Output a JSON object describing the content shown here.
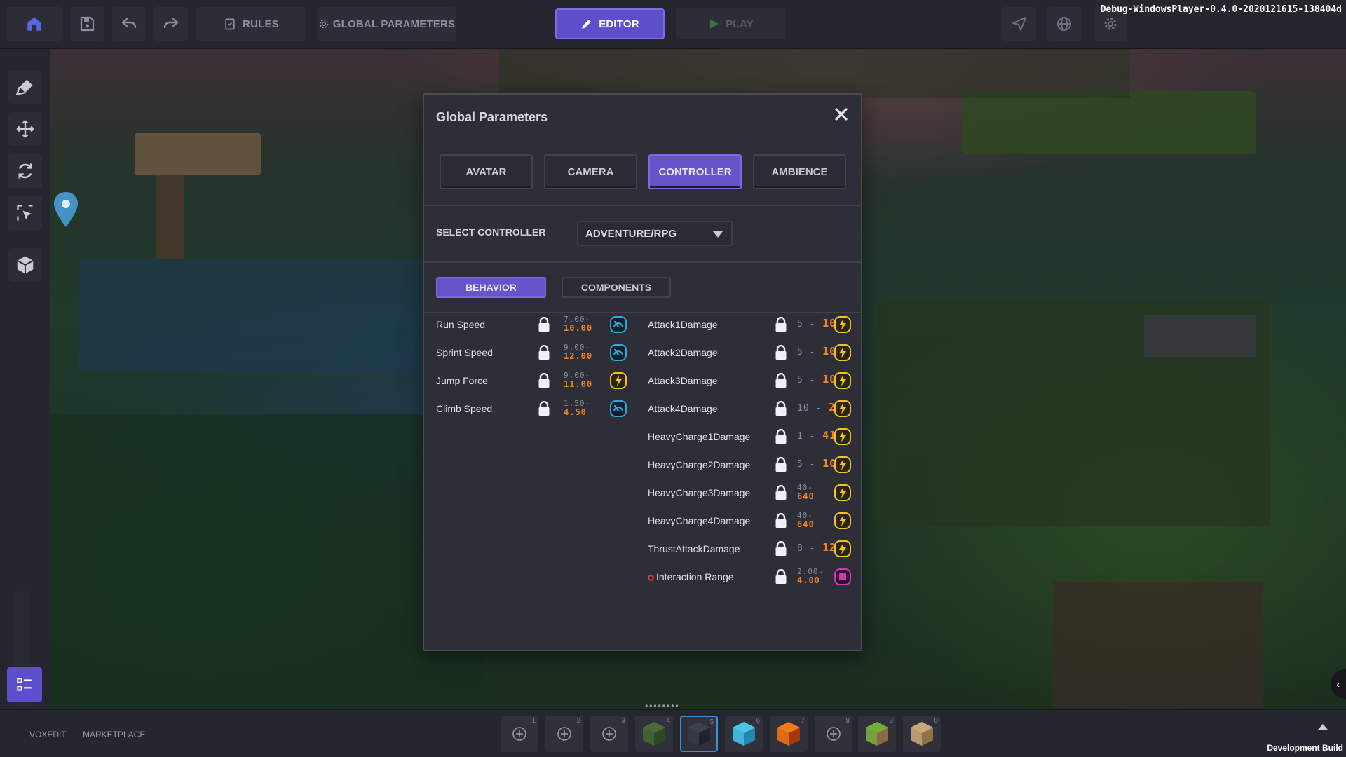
{
  "app": {
    "debug_build": "Debug-WindowsPlayer-0.4.0-2020121615-138404d",
    "development_build": "Development Build"
  },
  "topbar": {
    "rules_label": "RULES",
    "global_params_label": "GLOBAL PARAMETERS",
    "editor_label": "EDITOR",
    "play_label": "PLAY"
  },
  "bottombar": {
    "voxedit_label": "VOXEDIT",
    "marketplace_label": "MARKETPLACE",
    "slots": [
      {
        "num": "1",
        "icon": "add-icon"
      },
      {
        "num": "2",
        "icon": "add-icon"
      },
      {
        "num": "3",
        "icon": "add-icon"
      },
      {
        "num": "4",
        "icon": "plant-block-icon"
      },
      {
        "num": "5",
        "icon": "dark-block-icon",
        "selected": true
      },
      {
        "num": "6",
        "icon": "ice-block-icon"
      },
      {
        "num": "7",
        "icon": "lava-block-icon"
      },
      {
        "num": "8",
        "icon": "add-icon"
      },
      {
        "num": "9",
        "icon": "grass-block-icon"
      },
      {
        "num": "0",
        "icon": "sand-block-icon"
      }
    ]
  },
  "dialog": {
    "title": "Global Parameters",
    "tabs": [
      {
        "label": "AVATAR"
      },
      {
        "label": "CAMERA"
      },
      {
        "label": "CONTROLLER",
        "active": true
      },
      {
        "label": "AMBIENCE"
      }
    ],
    "select_controller_label": "SELECT CONTROLLER",
    "controller_value": "ADVENTURE/RPG",
    "subtabs": [
      {
        "label": "BEHAVIOR",
        "active": true
      },
      {
        "label": "COMPONENTS"
      }
    ],
    "left_params": [
      {
        "name": "Run Speed",
        "min": "7.00",
        "max": "10.00",
        "icon": "speed-gauge-icon"
      },
      {
        "name": "Sprint Speed",
        "min": "9.00",
        "max": "12.00",
        "icon": "speed-gauge-icon"
      },
      {
        "name": "Jump Force",
        "min": "9.00",
        "max": "11.00",
        "icon": "lightning-icon"
      },
      {
        "name": "Climb Speed",
        "min": "1.50",
        "max": "4.50",
        "icon": "speed-gauge-icon"
      }
    ],
    "right_params": [
      {
        "name": "Attack1Damage",
        "min": "5",
        "max": "105",
        "icon": "lightning-icon",
        "layout": "inline"
      },
      {
        "name": "Attack2Damage",
        "min": "5",
        "max": "105",
        "icon": "lightning-icon",
        "layout": "inline"
      },
      {
        "name": "Attack3Damage",
        "min": "5",
        "max": "105",
        "icon": "lightning-icon",
        "layout": "inline"
      },
      {
        "name": "Attack4Damage",
        "min": "10",
        "max": "210",
        "icon": "lightning-icon",
        "layout": "inline"
      },
      {
        "name": "HeavyCharge1Damage",
        "min": "1",
        "max": "41",
        "icon": "lightning-icon",
        "layout": "inline"
      },
      {
        "name": "HeavyCharge2Damage",
        "min": "5",
        "max": "105",
        "icon": "lightning-icon",
        "layout": "inline"
      },
      {
        "name": "HeavyCharge3Damage",
        "min": "40",
        "max": "640",
        "icon": "lightning-icon",
        "layout": "stacked"
      },
      {
        "name": "HeavyCharge4Damage",
        "min": "40",
        "max": "640",
        "icon": "lightning-icon",
        "layout": "stacked"
      },
      {
        "name": "ThrustAttackDamage",
        "min": "8",
        "max": "128",
        "icon": "lightning-icon",
        "layout": "inline"
      },
      {
        "name": "Interaction Range",
        "min": "2.00",
        "max": "4.00",
        "icon": "magenta-box-icon",
        "layout": "stacked",
        "warning": true
      }
    ]
  },
  "colors": {
    "accent": "#6655c9",
    "value_max": "#f0822a",
    "speed_icon": "#2fa7e0",
    "lightning_icon": "#f2c418",
    "magenta_icon": "#d236b4",
    "warning": "#e03a3a"
  }
}
